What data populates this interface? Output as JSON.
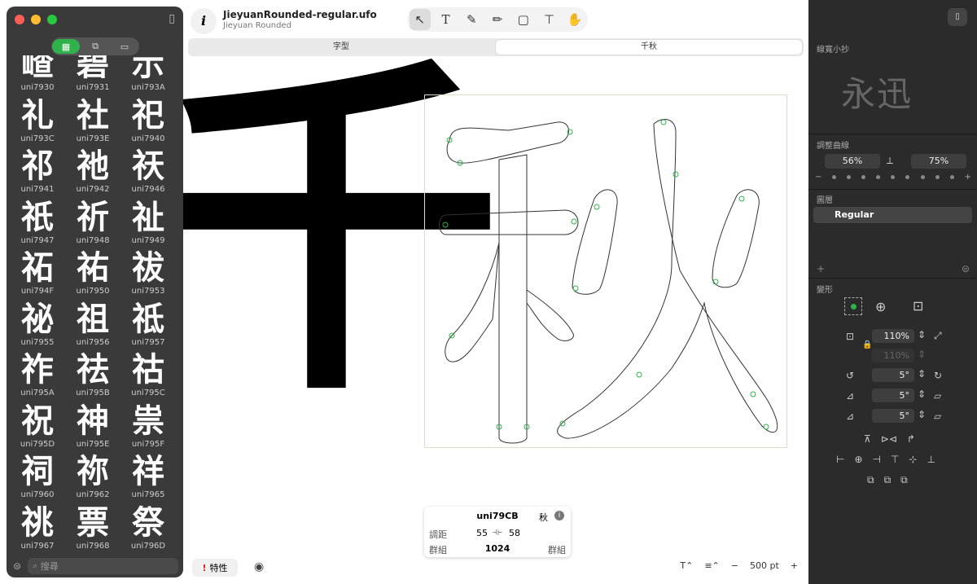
{
  "app": {
    "title": "JieyuanRounded-regular.ufo",
    "subtitle": "Jieyuan Rounded"
  },
  "sidebar": {
    "search_placeholder": "搜尋",
    "glyphs": [
      {
        "char": "嵖",
        "name": "uni7930"
      },
      {
        "char": "碧",
        "name": "uni7931"
      },
      {
        "char": "示",
        "name": "uni793A"
      },
      {
        "char": "礼",
        "name": "uni793C"
      },
      {
        "char": "社",
        "name": "uni793E"
      },
      {
        "char": "祀",
        "name": "uni7940"
      },
      {
        "char": "祁",
        "name": "uni7941"
      },
      {
        "char": "祂",
        "name": "uni7942"
      },
      {
        "char": "祆",
        "name": "uni7946"
      },
      {
        "char": "祇",
        "name": "uni7947"
      },
      {
        "char": "祈",
        "name": "uni7948"
      },
      {
        "char": "祉",
        "name": "uni7949"
      },
      {
        "char": "祏",
        "name": "uni794F"
      },
      {
        "char": "祐",
        "name": "uni7950"
      },
      {
        "char": "祓",
        "name": "uni7953"
      },
      {
        "char": "祕",
        "name": "uni7955"
      },
      {
        "char": "祖",
        "name": "uni7956"
      },
      {
        "char": "祗",
        "name": "uni7957"
      },
      {
        "char": "祚",
        "name": "uni795A"
      },
      {
        "char": "祛",
        "name": "uni795B"
      },
      {
        "char": "祜",
        "name": "uni795C"
      },
      {
        "char": "祝",
        "name": "uni795D"
      },
      {
        "char": "神",
        "name": "uni795E"
      },
      {
        "char": "祟",
        "name": "uni795F"
      },
      {
        "char": "祠",
        "name": "uni7960"
      },
      {
        "char": "祢",
        "name": "uni7962"
      },
      {
        "char": "祥",
        "name": "uni7965"
      },
      {
        "char": "祧",
        "name": "uni7967"
      },
      {
        "char": "票",
        "name": "uni7968"
      },
      {
        "char": "祭",
        "name": "uni796D"
      }
    ]
  },
  "tabs": [
    {
      "label": "字型",
      "active": false
    },
    {
      "label": "千秋",
      "active": true
    }
  ],
  "canvas": {
    "preview_glyph": "千"
  },
  "glyph_info": {
    "name": "uni79CB",
    "char": "秋",
    "label_spacing": "調距",
    "lsb": "55",
    "rsb": "58",
    "label_group": "群組",
    "width": "1024",
    "label_group_right": "群組"
  },
  "bottom": {
    "properties_label": "特性",
    "zoom": "500 pt"
  },
  "inspector": {
    "preview_label": "線寬小抄",
    "preview_text": "永迅",
    "curve_label": "調整曲線",
    "curve_left": "56%",
    "curve_right": "75%",
    "layers_label": "圖層",
    "layer_name": "Regular",
    "transform_label": "變形",
    "scale": "110%",
    "scale2": "110%",
    "rotate": "5°",
    "skew": "5°",
    "skew2": "5°"
  },
  "colors": {
    "accent": "#2fb24b",
    "sidebar_bg": "#3a3a3a",
    "inspector_bg": "#2b2b2b"
  }
}
